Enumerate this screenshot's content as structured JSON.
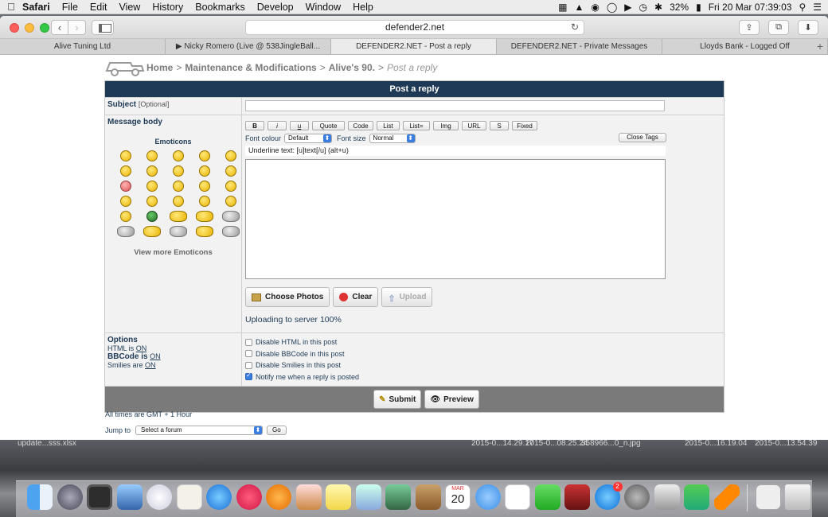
{
  "menubar": {
    "app": "Safari",
    "items": [
      "File",
      "Edit",
      "View",
      "History",
      "Bookmarks",
      "Develop",
      "Window",
      "Help"
    ],
    "battery": "32%",
    "clock": "Fri 20 Mar  07:39:03"
  },
  "browser": {
    "url": "defender2.net",
    "tabs": [
      {
        "label": "Alive Tuning Ltd",
        "active": false
      },
      {
        "label": "▶ Nicky Romero (Live @ 538JingleBall...",
        "active": false
      },
      {
        "label": "DEFENDER2.NET - Post a reply",
        "active": true
      },
      {
        "label": "DEFENDER2.NET - Private Messages",
        "active": false
      },
      {
        "label": "Lloyds Bank - Logged Off",
        "active": false
      }
    ],
    "new_tab": "+"
  },
  "breadcrumb": {
    "home": "Home",
    "section": "Maintenance & Modifications",
    "topic": "Alive's 90.",
    "current": "Post a reply",
    "sep": ">"
  },
  "form": {
    "title": "Post a reply",
    "subject_label": "Subject",
    "subject_optional": "[Optional]",
    "subject_value": "",
    "body_label": "Message body",
    "emoticons_title": "Emoticons",
    "view_more_emoticons": "View more Emoticons",
    "bbcode_buttons": [
      "B",
      "i",
      "u",
      "Quote",
      "Code",
      "List",
      "List=",
      "Img",
      "URL",
      "S",
      "Fixed"
    ],
    "font_colour_label": "Font colour",
    "font_colour_value": "Default",
    "font_size_label": "Font size",
    "font_size_value": "Normal",
    "close_tags": "Close Tags",
    "helpline": "Underline text: [u]text[/u]  (alt+u)",
    "message_value": "",
    "upload_buttons": {
      "choose": "Choose Photos",
      "clear": "Clear",
      "upload": "Upload"
    },
    "upload_status": "Uploading to server 100%",
    "options_title": "Options",
    "html_status": {
      "prefix": "HTML is",
      "value": "ON"
    },
    "bbcode_status": {
      "prefix": "BBCode is",
      "value": "ON"
    },
    "smilies_status": {
      "prefix": "Smilies are",
      "value": "ON"
    },
    "checkboxes": [
      {
        "label": "Disable HTML in this post",
        "checked": false
      },
      {
        "label": "Disable BBCode in this post",
        "checked": false
      },
      {
        "label": "Disable Smilies in this post",
        "checked": false
      },
      {
        "label": "Notify me when a reply is posted",
        "checked": true
      }
    ],
    "submit": "Submit",
    "preview": "Preview"
  },
  "footer": {
    "times": "All times are GMT + 1 Hour",
    "jump_label": "Jump to",
    "jump_value": "Select a forum",
    "go": "Go"
  },
  "desktop_files": [
    "update...sss.xlsx",
    "2015-0...14.29.17",
    "2015-0...08.25.24",
    "358966...0_n.jpg",
    "2015-0...16.19.04",
    "2015-0...13.54.39"
  ],
  "dock": {
    "calendar_month": "MAR",
    "calendar_day": "20",
    "app_store_badge": "2"
  }
}
